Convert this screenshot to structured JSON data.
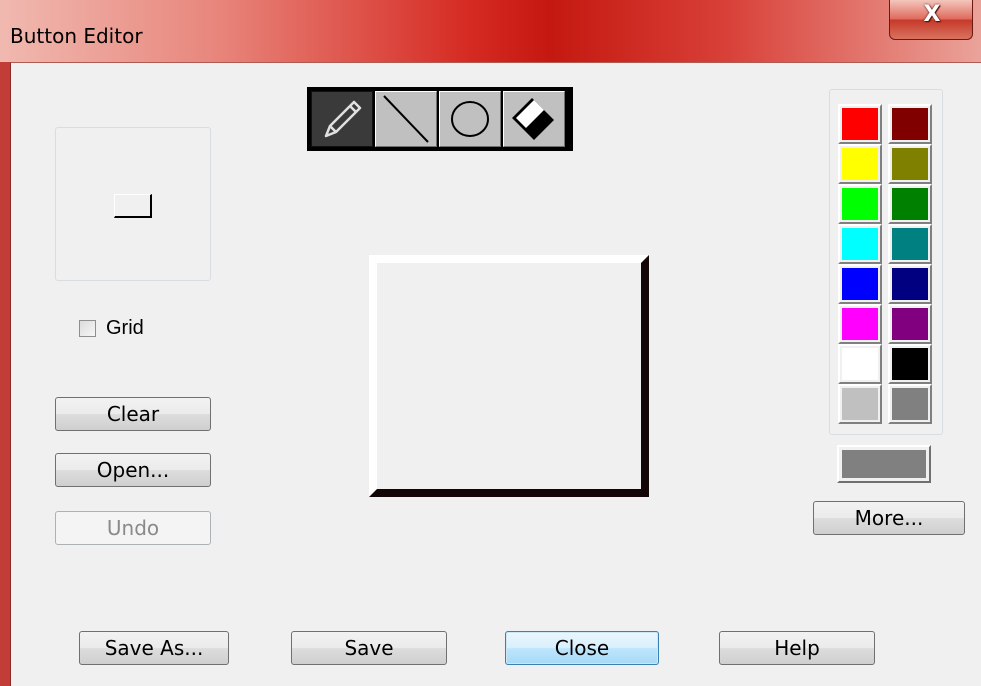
{
  "window": {
    "title": "Button Editor",
    "close_glyph": "X"
  },
  "preview": {
    "grid_label": "Grid",
    "grid_checked": false
  },
  "left_buttons": {
    "clear": "Clear",
    "open": "Open...",
    "undo": "Undo"
  },
  "toolbar": {
    "tools": [
      {
        "icon": "pencil-icon",
        "active": true
      },
      {
        "icon": "line-icon",
        "active": false
      },
      {
        "icon": "ellipse-icon",
        "active": false
      },
      {
        "icon": "eraser-icon",
        "active": false
      }
    ]
  },
  "palette": {
    "colors": [
      [
        "#ff0000",
        "#800000"
      ],
      [
        "#ffff00",
        "#808000"
      ],
      [
        "#00ff00",
        "#008000"
      ],
      [
        "#00ffff",
        "#008080"
      ],
      [
        "#0000ff",
        "#000080"
      ],
      [
        "#ff00ff",
        "#800080"
      ],
      [
        "#ffffff",
        "#000000"
      ],
      [
        "#c0c0c0",
        "#808080"
      ]
    ],
    "current_color": "#808080",
    "more_label": "More..."
  },
  "bottom_buttons": {
    "save_as": "Save As...",
    "save": "Save",
    "close": "Close",
    "help": "Help"
  }
}
